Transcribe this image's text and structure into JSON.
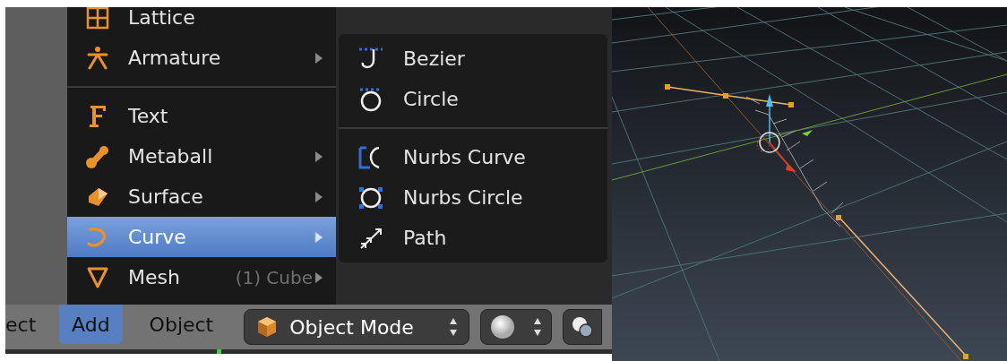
{
  "menu": {
    "items": [
      {
        "kind": "item",
        "label": "Lattice",
        "has_submenu": false,
        "selected": false
      },
      {
        "kind": "item",
        "label": "Armature",
        "has_submenu": true,
        "selected": false
      },
      {
        "kind": "separator"
      },
      {
        "kind": "item",
        "label": "Text",
        "has_submenu": false,
        "selected": false
      },
      {
        "kind": "item",
        "label": "Metaball",
        "has_submenu": true,
        "selected": false
      },
      {
        "kind": "item",
        "label": "Surface",
        "has_submenu": true,
        "selected": false
      },
      {
        "kind": "item",
        "label": "Curve",
        "has_submenu": true,
        "selected": true
      },
      {
        "kind": "item",
        "label": "Mesh",
        "has_submenu": true,
        "selected": false
      }
    ]
  },
  "viewport_label": "(1) Cube",
  "submenu": {
    "items": [
      {
        "kind": "item",
        "label": "Bezier"
      },
      {
        "kind": "item",
        "label": "Circle"
      },
      {
        "kind": "separator"
      },
      {
        "kind": "item",
        "label": "Nurbs Curve"
      },
      {
        "kind": "item",
        "label": "Nurbs Circle"
      },
      {
        "kind": "item",
        "label": "Path"
      }
    ]
  },
  "header": {
    "items": [
      {
        "label": "ect",
        "selected": false
      },
      {
        "label": "Add",
        "selected": true
      },
      {
        "label": "Object",
        "selected": false
      }
    ],
    "mode_dropdown": {
      "value": "Object Mode"
    }
  }
}
